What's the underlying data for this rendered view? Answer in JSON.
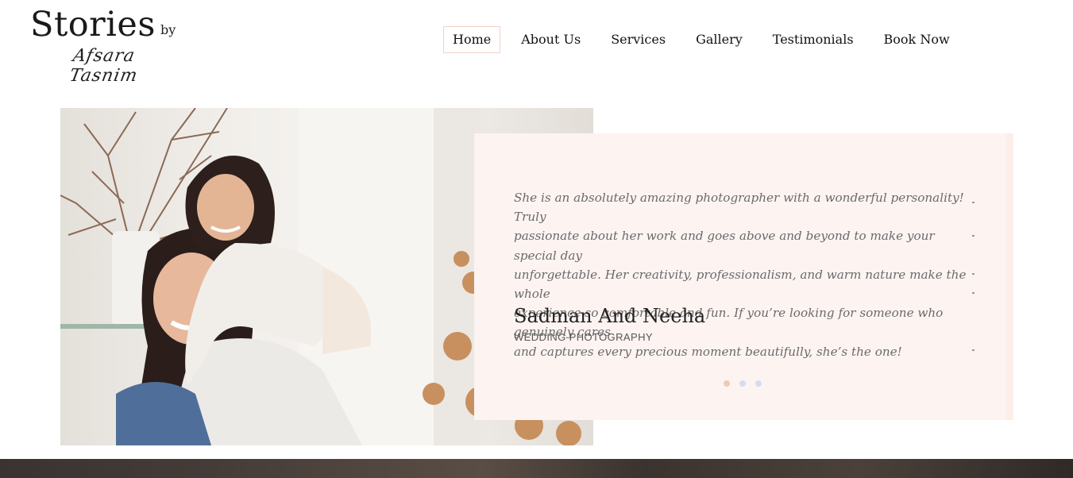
{
  "brand": {
    "title": "Stories",
    "by": "by",
    "signature": "Afsara Tasnim"
  },
  "nav": {
    "items": [
      {
        "label": "Home",
        "active": true
      },
      {
        "label": "About Us",
        "active": false
      },
      {
        "label": "Services",
        "active": false
      },
      {
        "label": "Gallery",
        "active": false
      },
      {
        "label": "Testimonials",
        "active": false
      },
      {
        "label": "Book Now",
        "active": false
      }
    ]
  },
  "testimonial": {
    "quote": "She is an absolutely amazing photographer with a wonderful personality! Truly\npassionate about her work and goes above and beyond to make your special day\nunforgettable. Her creativity, professionalism, and warm nature make the whole\nexperience so comfortable and fun. If you’re looking for someone who genuinely cares\nand captures every precious moment beautifully, she’s the one!",
    "author": "Sadman And Neeha",
    "service": "WEDDING PHOTOGRAPHY"
  },
  "slider": {
    "slide_count": 3,
    "active_index": 0
  },
  "colors": {
    "card_bg": "#fdf4f2",
    "active_border": "#f0d4c6",
    "dot_active": "#f0c9b8",
    "dot_inactive": "#d6dcef"
  }
}
